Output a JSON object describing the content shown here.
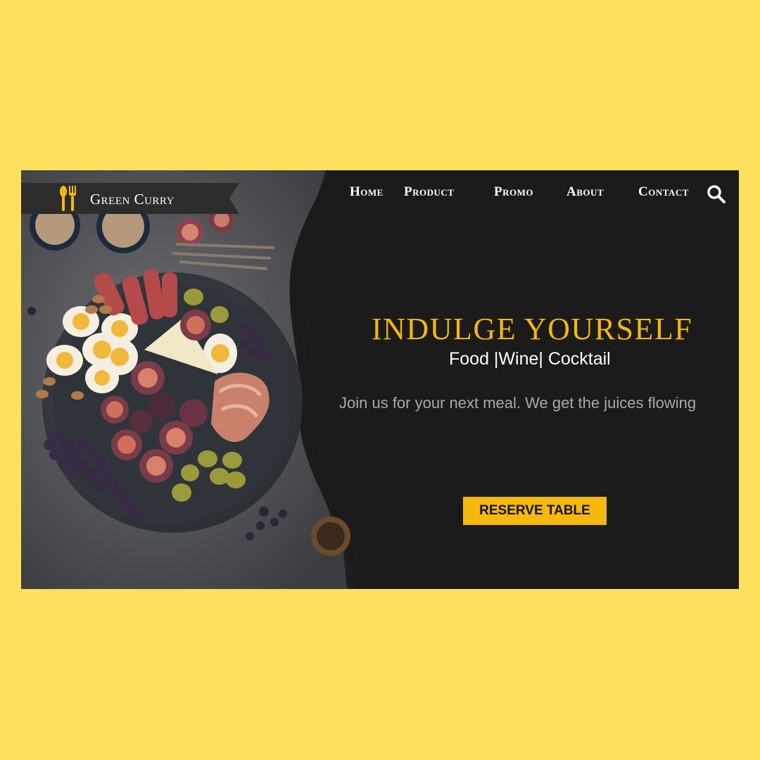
{
  "brand": {
    "name": "Green Curry",
    "accent": "#F5B80C",
    "background": "#FFDF5E",
    "panel": "#1b1b1c"
  },
  "nav": {
    "items": [
      {
        "label": "Home"
      },
      {
        "label": "Product"
      },
      {
        "label": "Promo"
      },
      {
        "label": "About"
      },
      {
        "label": "Contact"
      }
    ],
    "search_icon": "search-icon"
  },
  "hero": {
    "headline": "INDULGE YOURSELF",
    "subhead": "Food |Wine| Cocktail",
    "tagline": "Join us for your next meal. We get the juices flowing",
    "cta_label": "RESERVE TABLE"
  },
  "image": {
    "description_icon": "food-platter-image"
  }
}
